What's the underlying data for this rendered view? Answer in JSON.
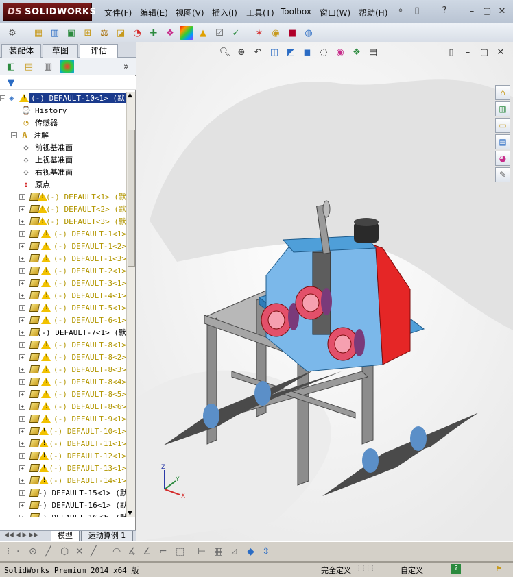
{
  "app": {
    "logo_text": "SOLIDWORKS",
    "logo_prefix": "DS"
  },
  "menu": {
    "items": [
      "文件(F)",
      "编辑(E)",
      "视图(V)",
      "插入(I)",
      "工具(T)",
      "Toolbox",
      "窗口(W)",
      "帮助(H)"
    ]
  },
  "tabs": [
    "装配体",
    "草图",
    "评估"
  ],
  "active_tab": "评估",
  "tree": {
    "root": "(-) DEFAULT-10<1> (默",
    "features": [
      {
        "label": "History",
        "icon": "history-icon"
      },
      {
        "label": "传感器",
        "icon": "sensor-icon"
      },
      {
        "label": "注解",
        "icon": "annotation-icon",
        "expandable": true
      },
      {
        "label": "前视基准面",
        "icon": "plane-icon"
      },
      {
        "label": "上视基准面",
        "icon": "plane-icon"
      },
      {
        "label": "右视基准面",
        "icon": "plane-icon"
      },
      {
        "label": "原点",
        "icon": "origin-icon"
      }
    ],
    "components": [
      {
        "label": "(-) DEFAULT<1> (默",
        "warn": true
      },
      {
        "label": "(-) DEFAULT<2> (默",
        "warn": true
      },
      {
        "label": "(-) DEFAULT<3> (默",
        "warn": true
      },
      {
        "label": "(-) DEFAULT-1<1>",
        "warn": true
      },
      {
        "label": "(-) DEFAULT-1<2>",
        "warn": true
      },
      {
        "label": "(-) DEFAULT-1<3>",
        "warn": true
      },
      {
        "label": "(-) DEFAULT-2<1>",
        "warn": true
      },
      {
        "label": "(-) DEFAULT-3<1>",
        "warn": true
      },
      {
        "label": "(-) DEFAULT-4<1>",
        "warn": true
      },
      {
        "label": "(-) DEFAULT-5<1>",
        "warn": true
      },
      {
        "label": "(-) DEFAULT-6<1>",
        "warn": true
      },
      {
        "label": "(-) DEFAULT-7<1> (默",
        "warn": false
      },
      {
        "label": "(-) DEFAULT-8<1>",
        "warn": true
      },
      {
        "label": "(-) DEFAULT-8<2>",
        "warn": true
      },
      {
        "label": "(-) DEFAULT-8<3>",
        "warn": true
      },
      {
        "label": "(-) DEFAULT-8<4>",
        "warn": true
      },
      {
        "label": "(-) DEFAULT-8<5>",
        "warn": true
      },
      {
        "label": "(-) DEFAULT-8<6>",
        "warn": true
      },
      {
        "label": "(-) DEFAULT-9<1>",
        "warn": true
      },
      {
        "label": "(-) DEFAULT-10<1>",
        "warn": true
      },
      {
        "label": "(-) DEFAULT-11<1>",
        "warn": true
      },
      {
        "label": "(-) DEFAULT-12<1>",
        "warn": true
      },
      {
        "label": "(-) DEFAULT-13<1>",
        "warn": true
      },
      {
        "label": "(-) DEFAULT-14<1>",
        "warn": true
      },
      {
        "label": "(-) DEFAULT-15<1> (默",
        "warn": false
      },
      {
        "label": "(-) DEFAULT-16<1> (默",
        "warn": false
      },
      {
        "label": "(-) DEFAULT-16<2> (默",
        "warn": false
      }
    ]
  },
  "bottom_tabs": [
    "模型",
    "运动算例 1"
  ],
  "status": {
    "app_text": "SolidWorks Premium 2014 x64 版",
    "state": "完全定义",
    "units": "自定义",
    "help_icon": "help-icon"
  },
  "colors": {
    "accent_red": "#d42a2a",
    "body_blue": "#6aaee8",
    "warn_text": "#b29600",
    "selection": "#1a3a8c"
  }
}
